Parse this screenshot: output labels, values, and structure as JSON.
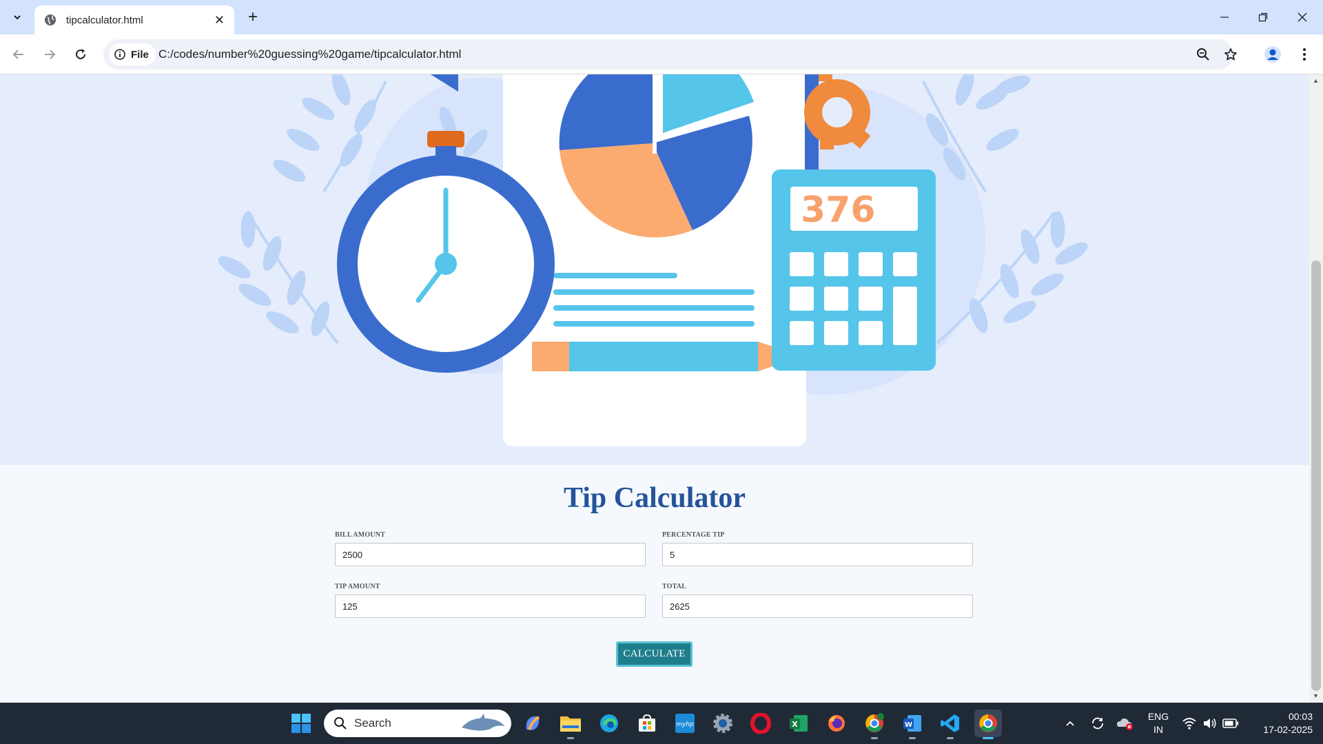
{
  "browser": {
    "tab_title": "tipcalculator.html",
    "new_tab_label": "+",
    "site_info_label": "File",
    "url": "C:/codes/number%20guessing%20game/tipcalculator.html"
  },
  "hero": {
    "calculator_display": "376"
  },
  "page": {
    "title": "Tip Calculator",
    "fields": {
      "bill_amount": {
        "label": "BILL AMOUNT",
        "value": "2500"
      },
      "percentage_tip": {
        "label": "PERCENTAGE TIP",
        "value": "5"
      },
      "tip_amount": {
        "label": "TIP AMOUNT",
        "value": "125"
      },
      "total": {
        "label": "TOTAL",
        "value": "2625"
      }
    },
    "calculate_label": "CALCULATE"
  },
  "taskbar": {
    "search_placeholder": "Search",
    "language_line1": "ENG",
    "language_line2": "IN",
    "time": "00:03",
    "date": "17-02-2025"
  },
  "colors": {
    "hero_background": "#e5edfc",
    "title": "#24549a",
    "button": "#1f7e8c",
    "button_border": "#56c3d4",
    "stopwatch": "#3a6ccd",
    "accent_light_blue": "#55c5ea",
    "accent_orange": "#fbab70"
  }
}
